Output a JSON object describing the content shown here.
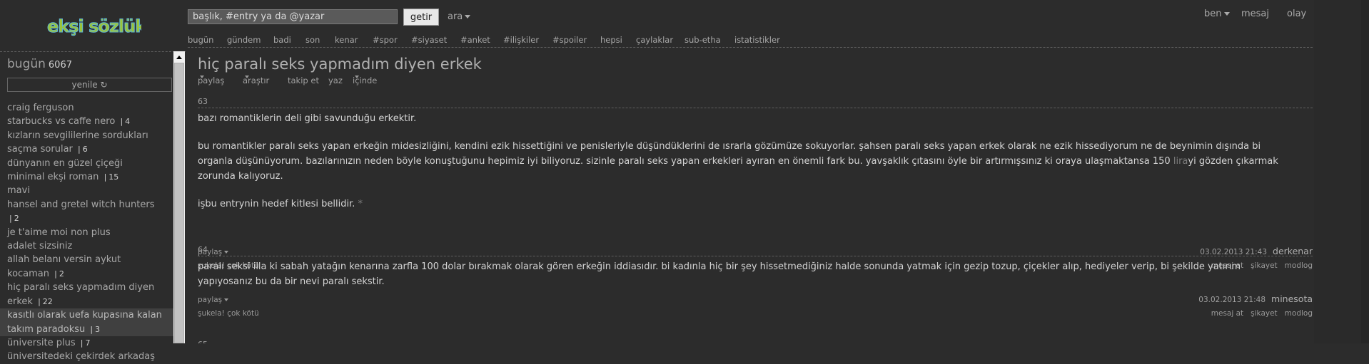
{
  "header": {
    "logo_text": "ekşi sözlük",
    "search": {
      "placeholder": "başlık, #entry ya da @yazar",
      "button_label": "getir",
      "menu_label": "ara"
    },
    "user_menu": {
      "me_label": "ben",
      "messages_label": "mesaj",
      "events_label": "olay"
    },
    "nav": [
      "bugün",
      "gündem",
      "badi",
      "son",
      "kenar",
      "#spor",
      "#siyaset",
      "#anket",
      "#ilişkiler",
      "#spoiler",
      "hepsi",
      "çaylaklar",
      "sub-etha",
      "istatistikler"
    ]
  },
  "sidebar": {
    "title": "bugün",
    "count": "6067",
    "refresh_label": "yenile ↻",
    "topics": [
      {
        "label": "craig ferguson",
        "count": ""
      },
      {
        "label": "starbucks vs caffe nero",
        "count": "4"
      },
      {
        "label": "kızların sevgililerine sordukları",
        "count": ""
      },
      {
        "label": "saçma sorular",
        "count": "6"
      },
      {
        "label": "dünyanın en güzel çiçeği",
        "count": ""
      },
      {
        "label": "minimal ekşi roman",
        "count": "15"
      },
      {
        "label": "mavi",
        "count": ""
      },
      {
        "label": "hansel and gretel witch hunters",
        "count": "2"
      },
      {
        "label": "je t'aime moi non plus",
        "count": ""
      },
      {
        "label": "adalet sizsiniz",
        "count": ""
      },
      {
        "label": "allah belanı versin aykut",
        "count": ""
      },
      {
        "label": "kocaman",
        "count": "2"
      },
      {
        "label": "hiç paralı seks yapmadım diyen erkek",
        "count": "22"
      },
      {
        "label": "kasıtlı olarak uefa kupasına kalan takım paradoksu",
        "count": "3"
      },
      {
        "label": "üniversite plus",
        "count": "7"
      },
      {
        "label": "üniversitedeki çekirdek arkadaş",
        "count": ""
      }
    ]
  },
  "main": {
    "title": "hiç paralı seks yapmadım diyen erkek",
    "toolbar": {
      "share": "paylaş",
      "search": "araştır",
      "follow": "takip et",
      "write": "yaz",
      "inside": "içinde"
    },
    "entries": [
      {
        "number": "63",
        "p1": "bazı romantiklerin deli gibi savunduğu erkektir.",
        "p2_a": "bu romantikler paralı seks yapan erkeğin midesizliğini, kendini ezik hissettiğini ve penisleriyle düşündüklerini de ısrarla gözümüze sokuyorlar. şahsen paralı seks yapan erkek olarak ne ezik hissediyorum ne de beynimin dışında bi organla düşünüyorum. bazılarınızın neden böyle konuştuğunu hepimiz iyi biliyoruz. sizinle paralı seks yapan erkekleri ayıran en önemli fark bu. yavşaklık çıtasını öyle bir artırmışsınız ki oraya ulaşmaktansa 150 ",
        "p2_link": "lira",
        "p2_b": "yi gözden çıkarmak zorunda kalıyoruz.",
        "p3_a": "işbu entrynin hedef kitlesi bellidir. ",
        "p3_link": "*",
        "share": "paylaş",
        "vote_up": "şukela!",
        "vote_down": "çok kötü",
        "date": "03.02.2013 21:43",
        "author": "derkenar",
        "actions": [
          "mesaj at",
          "şikayet",
          "modlog"
        ]
      },
      {
        "number": "64",
        "p1": "paralı seksi illa ki sabah yatağın kenarına zarfla 100 dolar bırakmak olarak gören erkeğin iddiasıdır. bi kadınla hiç bir şey hissetmediğiniz halde sonunda yatmak için gezip tozup, çiçekler alıp, hediyeler verip, bi şekilde yatırım yapıyosanız bu da bir nevi paralı sekstir.",
        "share": "paylaş",
        "vote_up": "şukela!",
        "vote_down": "çok kötü",
        "date": "03.02.2013 21:48",
        "author": "minesota",
        "actions": [
          "mesaj at",
          "şikayet",
          "modlog"
        ]
      },
      {
        "number": "65"
      }
    ]
  },
  "colors": {
    "background": "#2c2c2c",
    "logo_green": "#9bc43a",
    "logo_blue": "#5fb8d8",
    "text": "#d4d4d4"
  }
}
